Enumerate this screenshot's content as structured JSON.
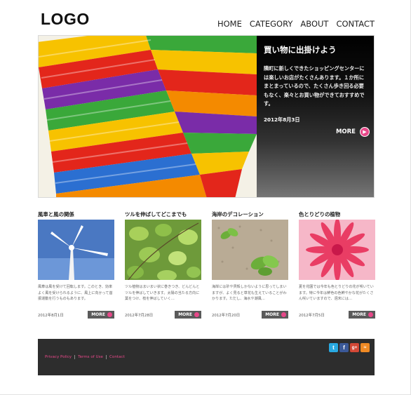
{
  "header": {
    "logo": "LOGO",
    "nav": [
      "HOME",
      "CATEGORY",
      "ABOUT",
      "CONTACT"
    ]
  },
  "hero": {
    "title": "買い物に出掛けよう",
    "body": "隣町に新しくできたショッピングセンターには楽しいお店がたくさんあります。１か所にまとまっているので、たくさん歩き回る必要もなく、楽々とお買い物ができておすすめです。",
    "date": "2012年8月3日",
    "more": "MORE"
  },
  "cards": [
    {
      "title": "風車と風の関係",
      "text": "風車は風を受けて回転します。このとき、効率よく風を受けられるように、風上に向かって首振運動を行うものもあります。",
      "date": "2012年8月1日",
      "more": "MORE"
    },
    {
      "title": "ツルを伸ばしてどこまでも",
      "text": "ツル植物はまいまい状に巻きつき、どんどんとツルを伸ばしていきます。太陽の当たる方向に葉をつけ、枝を伸ばしていく…",
      "date": "2012年7月28日",
      "more": "MORE"
    },
    {
      "title": "海岸のデコレーション",
      "text": "海岸には砂や貝殻しかないように思ってしまいますが、よく見ると草花も生えていることがわかります。ただし、海水や潮風…",
      "date": "2012年7月20日",
      "more": "MORE"
    },
    {
      "title": "色とりどりの植物",
      "text": "夏を花園では今年も色とりどりの花が咲いています。特に今年は鮮色の色鮮やかな花がたくさん咲いていますので、週末には…",
      "date": "2012年7月5日",
      "more": "MORE"
    }
  ],
  "footer": {
    "links": [
      "Privacy Policy",
      "Terms of Use",
      "Contact"
    ]
  },
  "social_icons": [
    "twitter-icon",
    "facebook-icon",
    "google-plus-icon",
    "rss-icon"
  ],
  "colors": {
    "accent": "#e74889",
    "footer_bg": "#2d2d2d",
    "more_button": "#5a5a5a"
  }
}
